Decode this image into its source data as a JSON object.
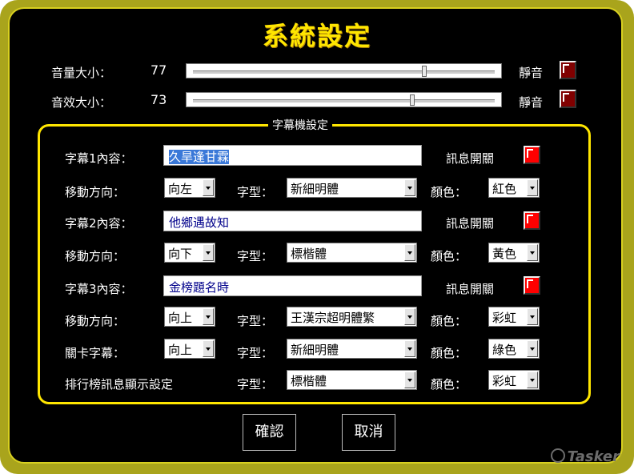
{
  "title": "系統設定",
  "volume": {
    "label": "音量大小：",
    "value": "77",
    "fraction": 0.77,
    "mute_label": "靜音"
  },
  "sfx": {
    "label": "音效大小：",
    "value": "73",
    "fraction": 0.73,
    "mute_label": "靜音"
  },
  "subtitle_group": {
    "title": "字幕機設定",
    "rows": [
      {
        "content_label": "字幕1內容：",
        "content": "久旱逢甘霖",
        "toggle_label": "訊息開關",
        "direction_label": "移動方向：",
        "direction": "向左",
        "font_label": "字型：",
        "font": "新細明體",
        "color_label": "顏色：",
        "color": "紅色"
      },
      {
        "content_label": "字幕2內容：",
        "content": "他鄉遇故知",
        "toggle_label": "訊息開關",
        "direction_label": "移動方向：",
        "direction": "向下",
        "font_label": "字型：",
        "font": "標楷體",
        "color_label": "顏色：",
        "color": "黃色"
      },
      {
        "content_label": "字幕3內容：",
        "content": "金榜題名時",
        "toggle_label": "訊息開關",
        "direction_label": "移動方向：",
        "direction": "向上",
        "font_label": "字型：",
        "font": "王漢宗超明體繁",
        "color_label": "顏色：",
        "color": "彩虹"
      }
    ],
    "stage": {
      "label": "關卡字幕：",
      "direction": "向上",
      "font_label": "字型：",
      "font": "新細明體",
      "color_label": "顏色：",
      "color": "綠色"
    },
    "ranking": {
      "label": "排行榜訊息顯示設定",
      "font_label": "字型：",
      "font": "標楷體",
      "color_label": "顏色：",
      "color": "彩虹"
    }
  },
  "buttons": {
    "ok": "確認",
    "cancel": "取消"
  },
  "watermark": "Tasker",
  "colors": {
    "accent": "#ffe600",
    "frame": "#a9a41c",
    "background": "#000000",
    "checkbox_on": "#ff0000",
    "checkbox_off": "#800000"
  }
}
